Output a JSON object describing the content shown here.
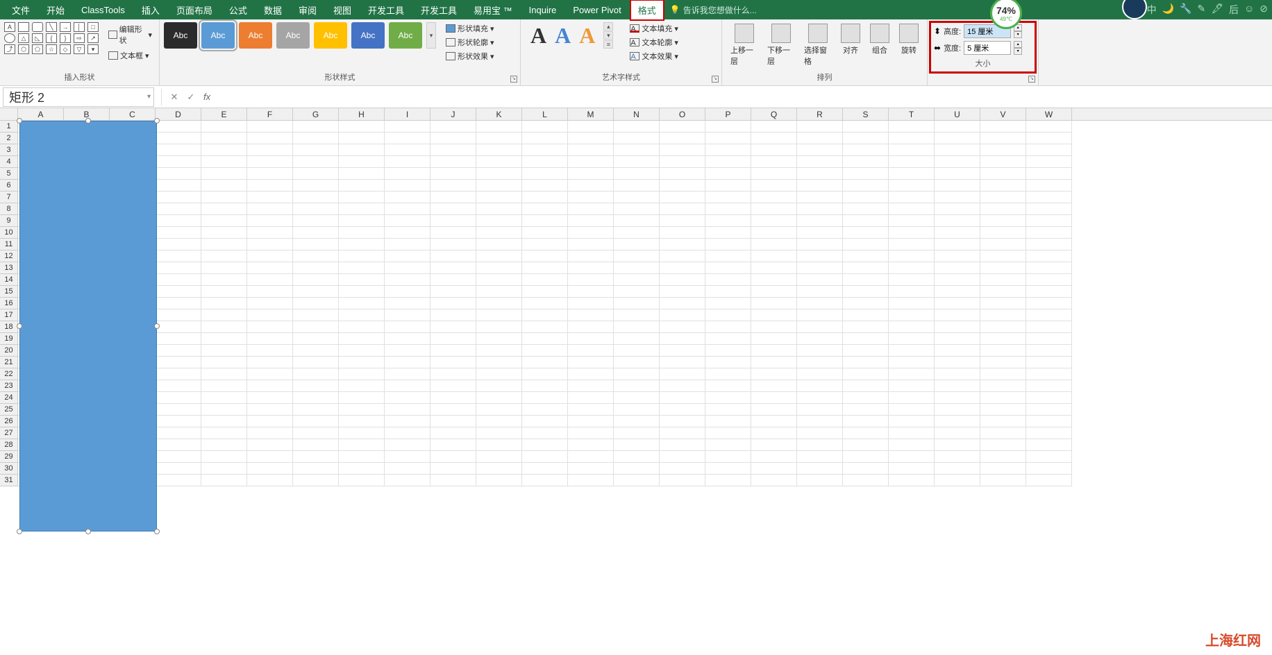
{
  "menu": {
    "items": [
      "文件",
      "开始",
      "ClassTools",
      "插入",
      "页面布局",
      "公式",
      "数据",
      "审阅",
      "视图",
      "开发工具",
      "开发工具",
      "易用宝 ™",
      "Inquire",
      "Power Pivot",
      "格式"
    ],
    "active_index": 14,
    "tell_me": "告诉我您想做什么...",
    "badge_percent": "74%",
    "badge_temp": "49℃",
    "right_icons": [
      "中",
      "🌙",
      "🔧",
      "✎",
      "🖋",
      "后",
      "☺",
      "⊘"
    ]
  },
  "ribbon": {
    "insert_shapes": {
      "label": "插入形状",
      "edit_shape": "编辑形状",
      "text_box": "文本框"
    },
    "shape_styles": {
      "label": "形状样式",
      "swatches": [
        {
          "text": "Abc",
          "bg": "#2b2b2b"
        },
        {
          "text": "Abc",
          "bg": "#5b9bd5"
        },
        {
          "text": "Abc",
          "bg": "#ed7d31"
        },
        {
          "text": "Abc",
          "bg": "#a5a5a5"
        },
        {
          "text": "Abc",
          "bg": "#ffc000"
        },
        {
          "text": "Abc",
          "bg": "#4472c4"
        },
        {
          "text": "Abc",
          "bg": "#70ad47"
        }
      ],
      "fill": "形状填充",
      "outline": "形状轮廓",
      "effects": "形状效果"
    },
    "wordart": {
      "label": "艺术字样式",
      "text_fill": "文本填充",
      "text_outline": "文本轮廓",
      "text_effects": "文本效果"
    },
    "arrange": {
      "label": "排列",
      "bring_forward": "上移一层",
      "send_backward": "下移一层",
      "selection_pane": "选择窗格",
      "align": "对齐",
      "group": "组合",
      "rotate": "旋转"
    },
    "size": {
      "label": "大小",
      "height_label": "高度:",
      "width_label": "宽度:",
      "height_value": "15 厘米",
      "width_value": "5 厘米"
    }
  },
  "formula_bar": {
    "name_box": "矩形 2",
    "formula": ""
  },
  "grid": {
    "columns": [
      "A",
      "B",
      "C",
      "D",
      "E",
      "F",
      "G",
      "H",
      "I",
      "J",
      "K",
      "L",
      "M",
      "N",
      "O",
      "P",
      "Q",
      "R",
      "S",
      "T",
      "U",
      "V",
      "W"
    ],
    "rows": 31
  },
  "watermark": "上海红网"
}
